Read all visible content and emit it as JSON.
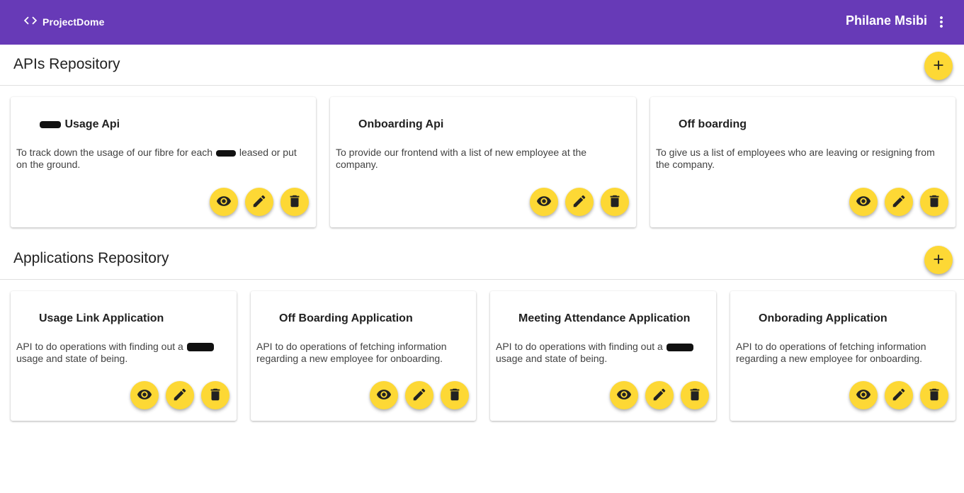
{
  "header": {
    "brand_name": "ProjectDome",
    "user_name": "Philane Msibi",
    "bg_color": "#673ab7"
  },
  "accent_color": "#fdd835",
  "apis": {
    "title": "APIs Repository",
    "cards": [
      {
        "title": "Usage Api",
        "desc_1": "To track down the usage of our fibre for each",
        "desc_2": "leased or put on the ground."
      },
      {
        "title": "Onboarding Api",
        "desc": "To provide our frontend with a list of new employee at the company."
      },
      {
        "title": "Off boarding",
        "desc": "To give us a list of employees who are leaving or resigning from the company."
      }
    ]
  },
  "applications": {
    "title": "Applications Repository",
    "cards": [
      {
        "title": "Usage Link Application",
        "desc_1": "API to do operations with finding out a",
        "desc_2": "usage and state of being."
      },
      {
        "title": "Off Boarding Application",
        "desc": "API to do operations of fetching information regarding a new employee for onboarding."
      },
      {
        "title": "Meeting Attendance Application",
        "desc_1": "API to do operations with finding out a",
        "desc_2": "usage and state of being."
      },
      {
        "title": "Onborading Application",
        "desc": "API to do operations of fetching information regarding a new employee for onboarding."
      }
    ]
  },
  "icons": {
    "brand": "code-icon",
    "menu": "more-vert-icon",
    "add": "add-icon",
    "view": "eye-icon",
    "edit": "pencil-icon",
    "delete": "trash-icon"
  }
}
